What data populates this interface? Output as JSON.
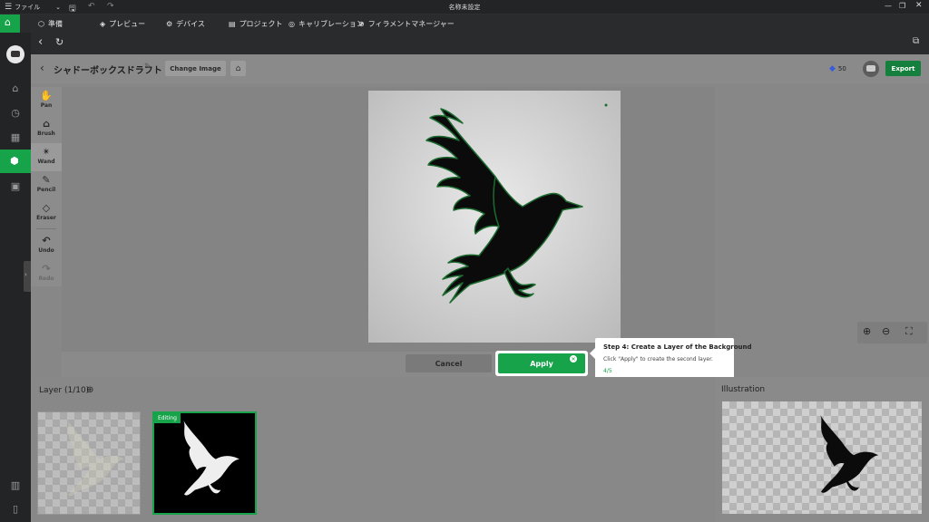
{
  "window": {
    "title": "名称未設定",
    "menu_label": "ファイル"
  },
  "menubar": {
    "items": [
      {
        "label": "準備",
        "icon": "box-icon"
      },
      {
        "label": "プレビュー",
        "icon": "layers-icon"
      },
      {
        "label": "デバイス",
        "icon": "device-icon"
      },
      {
        "label": "プロジェクト",
        "icon": "project-icon"
      },
      {
        "label": "キャリブレーション",
        "icon": "calibration-icon"
      },
      {
        "label": "フィラメントマネージャー",
        "icon": "filament-icon"
      }
    ]
  },
  "header": {
    "title": "シャドーボックスドラフト",
    "change_image_label": "Change Image",
    "credits": "50",
    "export_label": "Export"
  },
  "tools": [
    {
      "label": "Pan",
      "icon": "hand-icon",
      "glyph": "✋"
    },
    {
      "label": "Brush",
      "icon": "brush-icon",
      "glyph": "⌂"
    },
    {
      "label": "Wand",
      "icon": "magic-wand-icon",
      "glyph": "✴"
    },
    {
      "label": "Pencil",
      "icon": "pencil-icon",
      "glyph": "✎"
    },
    {
      "label": "Eraser",
      "icon": "eraser-icon",
      "glyph": "◇"
    },
    {
      "label": "Undo",
      "icon": "undo-icon",
      "glyph": "↶"
    },
    {
      "label": "Redo",
      "icon": "redo-icon",
      "glyph": "↷"
    }
  ],
  "actions": {
    "cancel_label": "Cancel",
    "apply_label": "Apply"
  },
  "tooltip": {
    "title": "Step 4: Create a Layer of the Background",
    "body": "Click \"Apply\" to create the second layer.",
    "progress": "4/5"
  },
  "layers": {
    "title": "Layer (1/10)",
    "editing_badge": "Editing"
  },
  "illustration": {
    "title": "Illustration"
  },
  "colors": {
    "accent": "#16a34a"
  }
}
